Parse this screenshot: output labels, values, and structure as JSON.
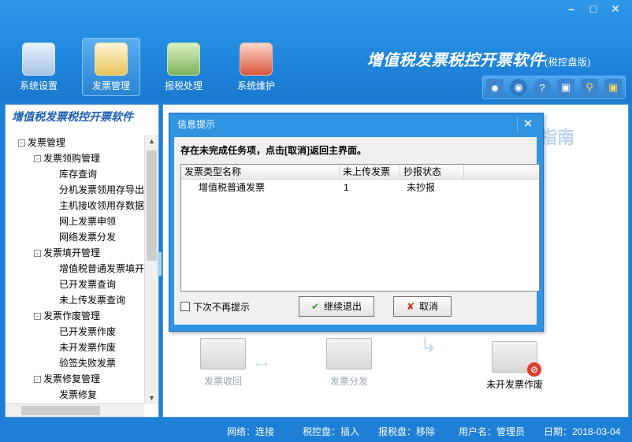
{
  "window": {
    "minimize": "–",
    "maximize": "□",
    "close": "✕"
  },
  "toolbar": [
    {
      "label": "系统设置",
      "icon": "settings-icon"
    },
    {
      "label": "发票管理",
      "icon": "invoice-icon"
    },
    {
      "label": "报税处理",
      "icon": "tax-filing-icon"
    },
    {
      "label": "系统维护",
      "icon": "maintenance-icon"
    }
  ],
  "app_title": "增值税发票税控开票软件",
  "app_subtitle": "(税控盘版)",
  "quick_icons": [
    "user-icon",
    "globe-icon",
    "help-icon",
    "window-icon",
    "key-icon",
    "lock-icon"
  ],
  "left_panel": {
    "title": "增值税发票税控开票软件",
    "tree": [
      {
        "label": "发票管理",
        "level": 0,
        "toggle": "-"
      },
      {
        "label": "发票领购管理",
        "level": 1,
        "toggle": "-"
      },
      {
        "label": "库存查询",
        "level": 2
      },
      {
        "label": "分机发票领用存导出",
        "level": 2
      },
      {
        "label": "主机接收领用存数据",
        "level": 2
      },
      {
        "label": "网上发票申领",
        "level": 2
      },
      {
        "label": "网络发票分发",
        "level": 2
      },
      {
        "label": "发票填开管理",
        "level": 1,
        "toggle": "-"
      },
      {
        "label": "增值税普通发票填开",
        "level": 2
      },
      {
        "label": "已开发票查询",
        "level": 2
      },
      {
        "label": "未上传发票查询",
        "level": 2
      },
      {
        "label": "发票作废管理",
        "level": 1,
        "toggle": "-"
      },
      {
        "label": "已开发票作废",
        "level": 2
      },
      {
        "label": "未开发票作废",
        "level": 2
      },
      {
        "label": "验签失败发票",
        "level": 2
      },
      {
        "label": "发票修复管理",
        "level": 1,
        "toggle": "-"
      },
      {
        "label": "发票修复",
        "level": 2
      }
    ]
  },
  "main": {
    "guide_text": "指南",
    "flow": [
      "发票收回",
      "发票分发",
      "未开发票作废"
    ]
  },
  "dialog": {
    "title": "信息提示",
    "close": "✕",
    "message": "存在未完成任务项，点击[取消]返回主界面。",
    "columns": [
      "发票类型名称",
      "未上传发票",
      "抄报状态"
    ],
    "rows": [
      {
        "type": "增值税普通发票",
        "count": "1",
        "status": "未抄报"
      }
    ],
    "checkbox_label": "下次不再提示",
    "continue_label": "继续退出",
    "cancel_label": "取消"
  },
  "status": {
    "network": "网络：连接",
    "tax_disk": "税控盘：插入",
    "report_disk": "报税盘：移除",
    "user": "用户名：管理员",
    "date": "日期：2018-03-04"
  }
}
